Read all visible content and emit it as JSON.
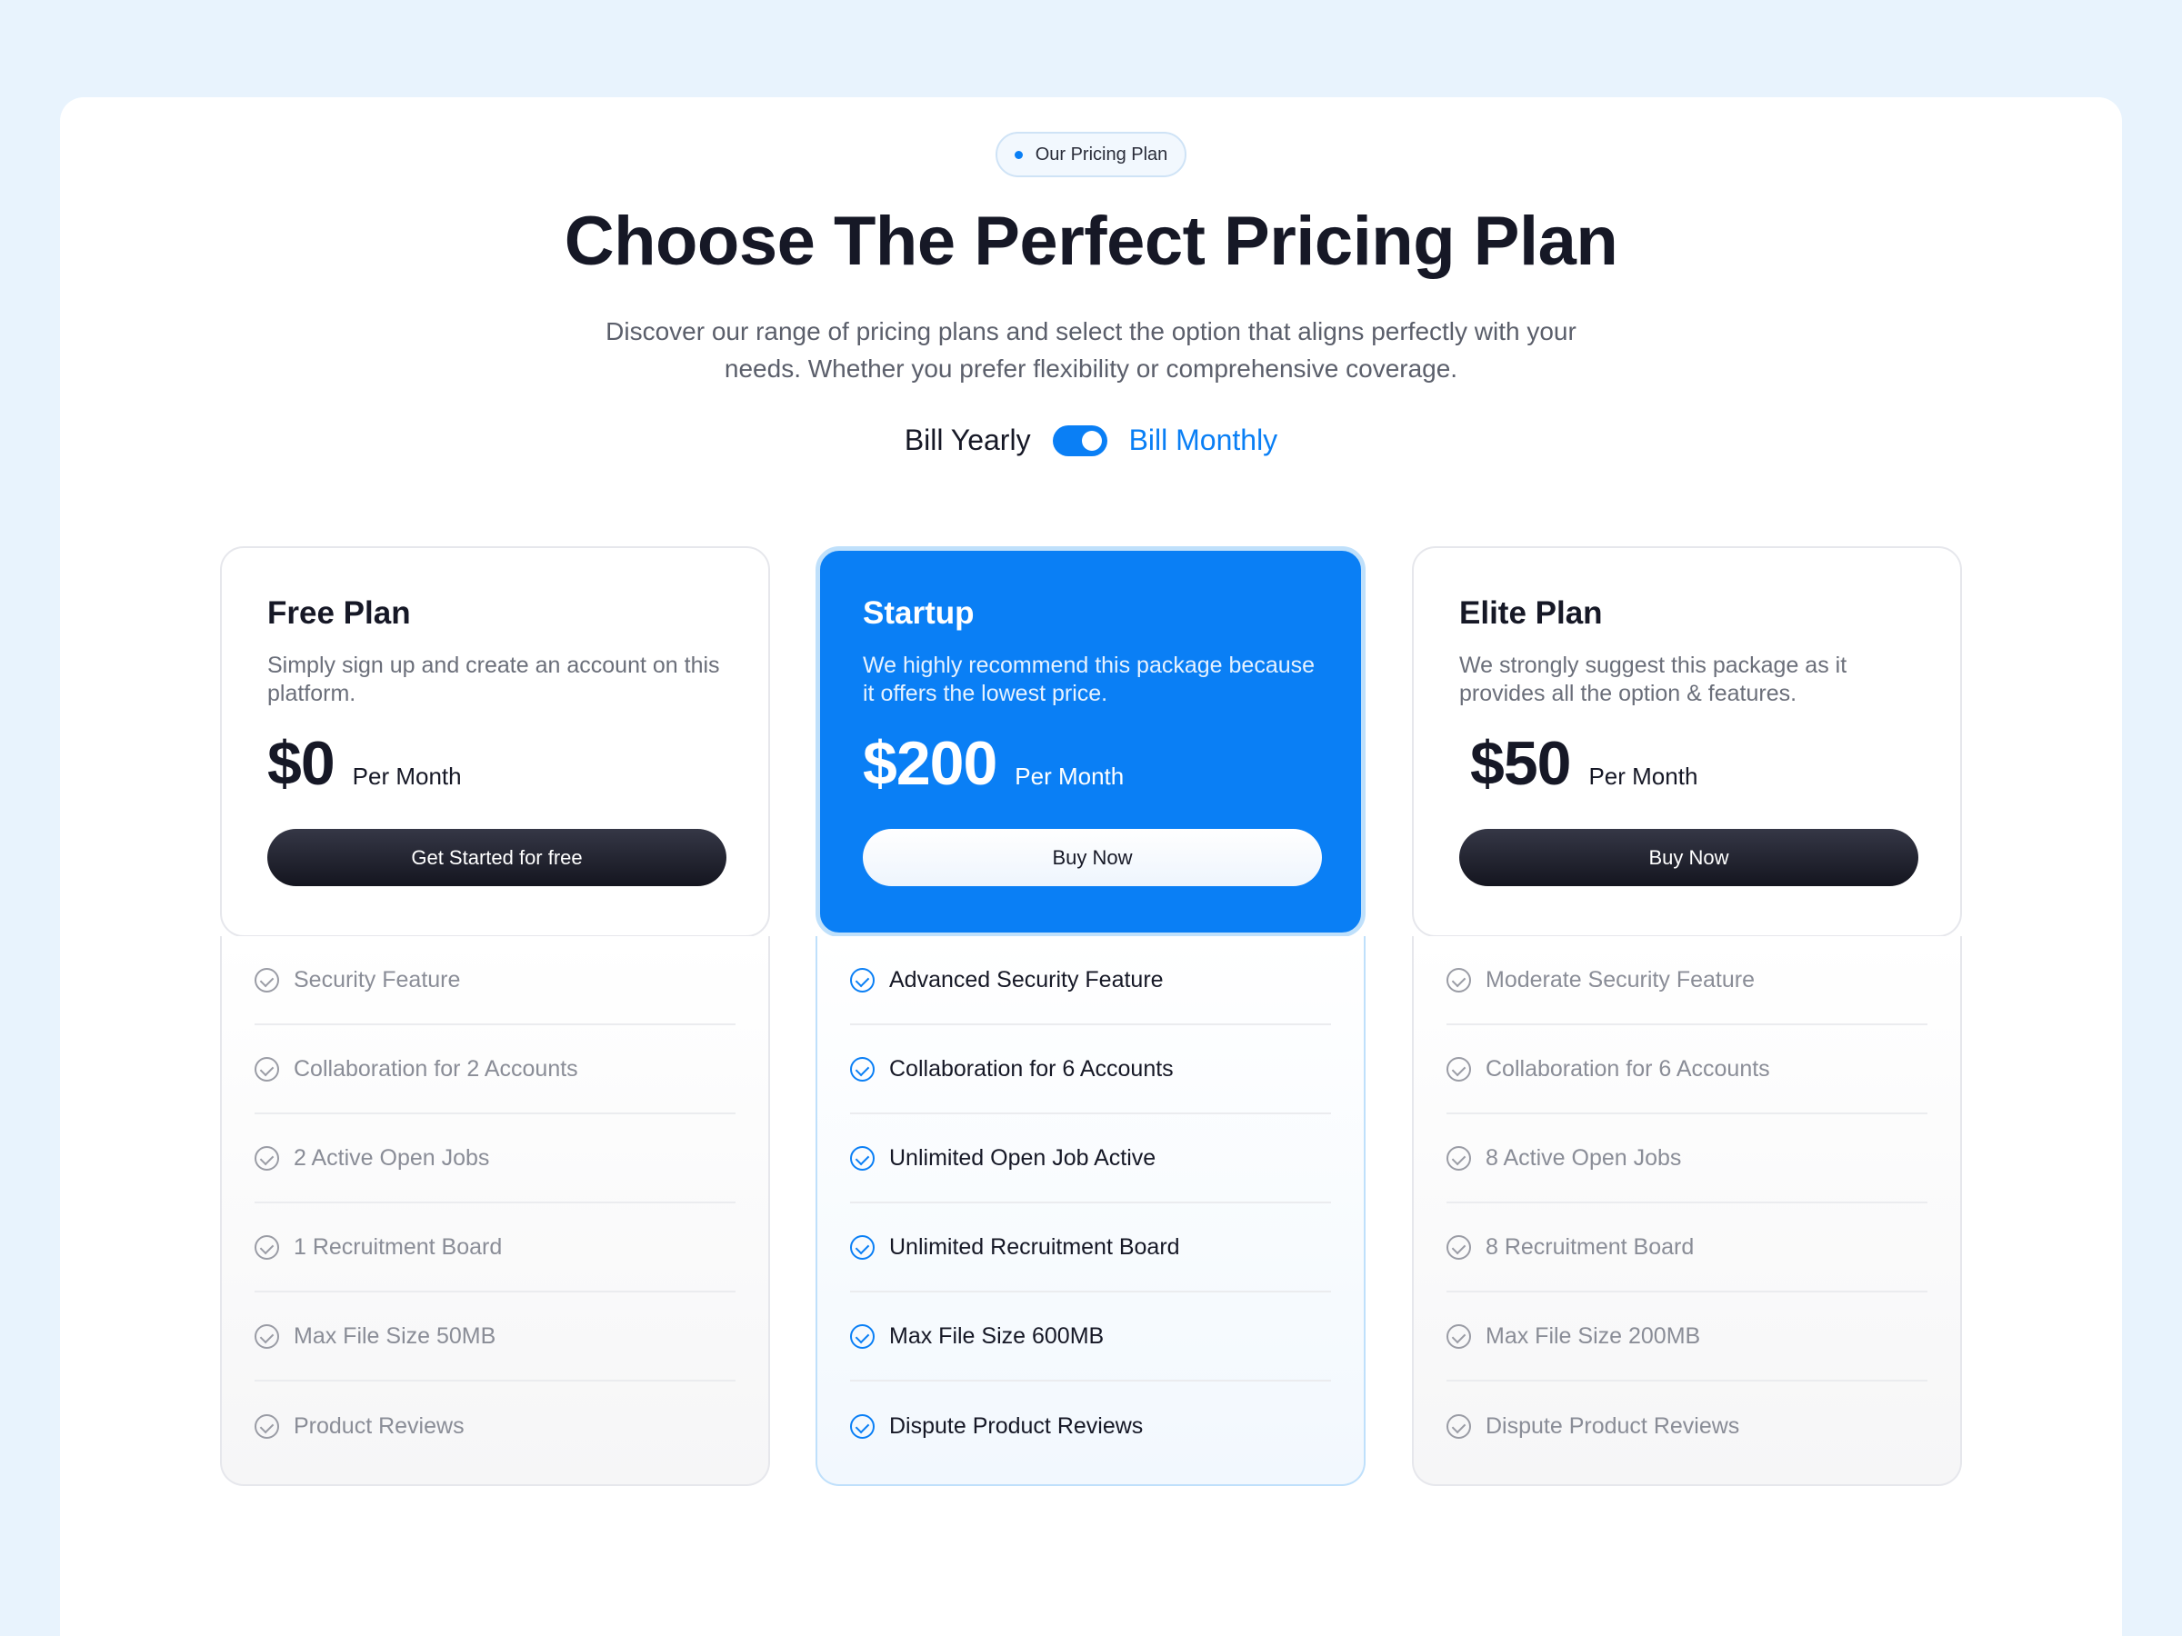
{
  "badge": {
    "label": "Our Pricing Plan"
  },
  "header": {
    "title": "Choose The Perfect Pricing Plan",
    "subtitle": "Discover our range of pricing plans and select the option that aligns perfectly with your needs. Whether you prefer flexibility or comprehensive coverage."
  },
  "billing": {
    "yearly_label": "Bill Yearly",
    "monthly_label": "Bill Monthly",
    "selected": "Bill Monthly"
  },
  "colors": {
    "accent": "#0a7ff5",
    "dark": "#161826",
    "background": "#e8f3fd"
  },
  "plans": [
    {
      "name": "Free Plan",
      "description": "Simply sign up and create an account on this platform.",
      "price": "$0",
      "period": "Per Month",
      "cta": "Get Started for free",
      "features": [
        "Security Feature",
        "Collaboration for 2 Accounts",
        "2 Active Open Jobs",
        "1 Recruitment Board",
        "Max File Size 50MB",
        "Product Reviews"
      ]
    },
    {
      "name": "Startup",
      "description": "We highly recommend this package because it offers the lowest price.",
      "price": "$200",
      "period": "Per Month",
      "cta": "Buy Now",
      "features": [
        "Advanced Security Feature",
        "Collaboration for 6 Accounts",
        "Unlimited Open Job Active",
        "Unlimited Recruitment Board",
        "Max File Size 600MB",
        "Dispute Product Reviews"
      ]
    },
    {
      "name": "Elite Plan",
      "description": "We strongly suggest this package as it provides all the option & features.",
      "price": "$50",
      "period": "Per Month",
      "cta": "Buy Now",
      "features": [
        "Moderate Security Feature",
        "Collaboration for 6 Accounts",
        "8 Active Open Jobs",
        "8 Recruitment Board",
        "Max File Size 200MB",
        "Dispute Product Reviews"
      ]
    }
  ]
}
